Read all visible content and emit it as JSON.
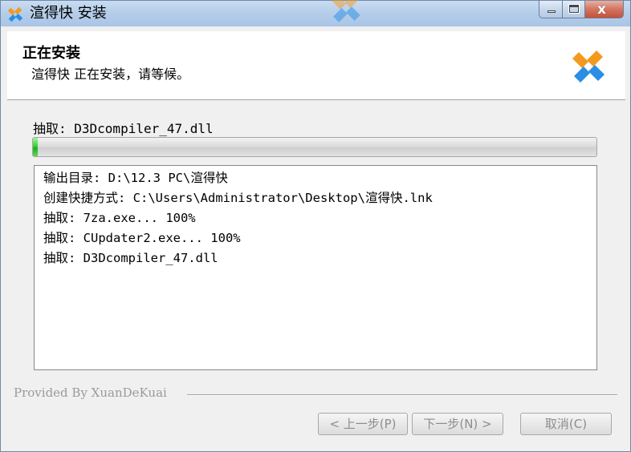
{
  "window": {
    "title": "渲得快 安装",
    "close_glyph": "x"
  },
  "header": {
    "title": "正在安装",
    "subtitle": "渲得快 正在安装，请等候。"
  },
  "progress": {
    "current_label": "抽取: D3Dcompiler_47.dll",
    "fraction": 0.008
  },
  "log": {
    "lines": [
      "输出目录: D:\\12.3 PC\\渲得快",
      "创建快捷方式: C:\\Users\\Administrator\\Desktop\\渲得快.lnk",
      "抽取: 7za.exe... 100%",
      "抽取: CUpdater2.exe... 100%",
      "抽取: D3Dcompiler_47.dll"
    ]
  },
  "footer": {
    "brand": "Provided By XuanDeKuai",
    "back_label": "< 上一步(P)",
    "next_label": "下一步(N) >",
    "cancel_label": "取消(C)"
  },
  "colors": {
    "logo_orange": "#f39a1e",
    "logo_blue": "#2a8ee6",
    "progress_green": "#3ccf3a"
  }
}
